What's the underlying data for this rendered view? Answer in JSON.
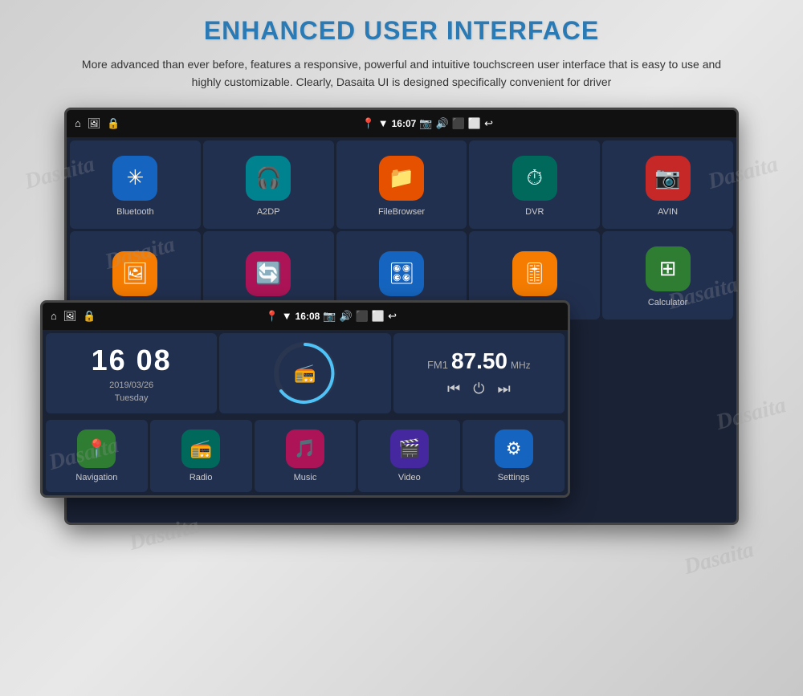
{
  "page": {
    "title": "Enhanced User Interface",
    "subtitle": "More advanced than ever before, features a responsive, powerful and intuitive touchscreen user interface that is easy to use and highly customizable. Clearly, Dasaita UI is designed specifically convenient for driver"
  },
  "watermarks": [
    "Dasaita",
    "Dasaita",
    "Dasaita",
    "Dasaita"
  ],
  "backScreen": {
    "statusBar": {
      "time": "16:07",
      "icons": [
        "home",
        "image",
        "lock",
        "pin",
        "wifi",
        "camera",
        "volume",
        "window",
        "window2",
        "back"
      ]
    },
    "apps": [
      {
        "label": "Bluetooth",
        "icon": "⚡",
        "bg": "bg-blue"
      },
      {
        "label": "A2DP",
        "icon": "🎧",
        "bg": "bg-teal"
      },
      {
        "label": "FileBrowser",
        "icon": "📁",
        "bg": "bg-orange"
      },
      {
        "label": "DVR",
        "icon": "⏱",
        "bg": "bg-dark-teal"
      },
      {
        "label": "AVIN",
        "icon": "📷",
        "bg": "bg-pink"
      },
      {
        "label": "",
        "icon": "🖼",
        "bg": "bg-img"
      },
      {
        "label": "",
        "icon": "🔄",
        "bg": "bg-magenta"
      },
      {
        "label": "",
        "icon": "🎛",
        "bg": "bg-blue2"
      },
      {
        "label": "",
        "icon": "🎚",
        "bg": "bg-amber"
      },
      {
        "label": "Calculator",
        "icon": "🧮",
        "bg": "bg-green"
      }
    ]
  },
  "frontScreen": {
    "statusBar": {
      "time": "16:08",
      "icons": [
        "home",
        "image",
        "lock",
        "pin",
        "wifi",
        "camera",
        "volume",
        "window",
        "window2",
        "back"
      ]
    },
    "clock": {
      "time": "16 08",
      "date": "2019/03/26",
      "day": "Tuesday"
    },
    "radio": {
      "band": "FM1",
      "frequency": "87.50",
      "unit": "MHz"
    },
    "bottomNav": [
      {
        "label": "Navigation",
        "icon": "📍",
        "bg": "bg-nav-green"
      },
      {
        "label": "Radio",
        "icon": "📻",
        "bg": "bg-nav-teal"
      },
      {
        "label": "Music",
        "icon": "🎵",
        "bg": "bg-nav-pink"
      },
      {
        "label": "Video",
        "icon": "🎬",
        "bg": "bg-nav-purple"
      },
      {
        "label": "Settings",
        "icon": "⚙",
        "bg": "bg-nav-blue"
      }
    ]
  }
}
